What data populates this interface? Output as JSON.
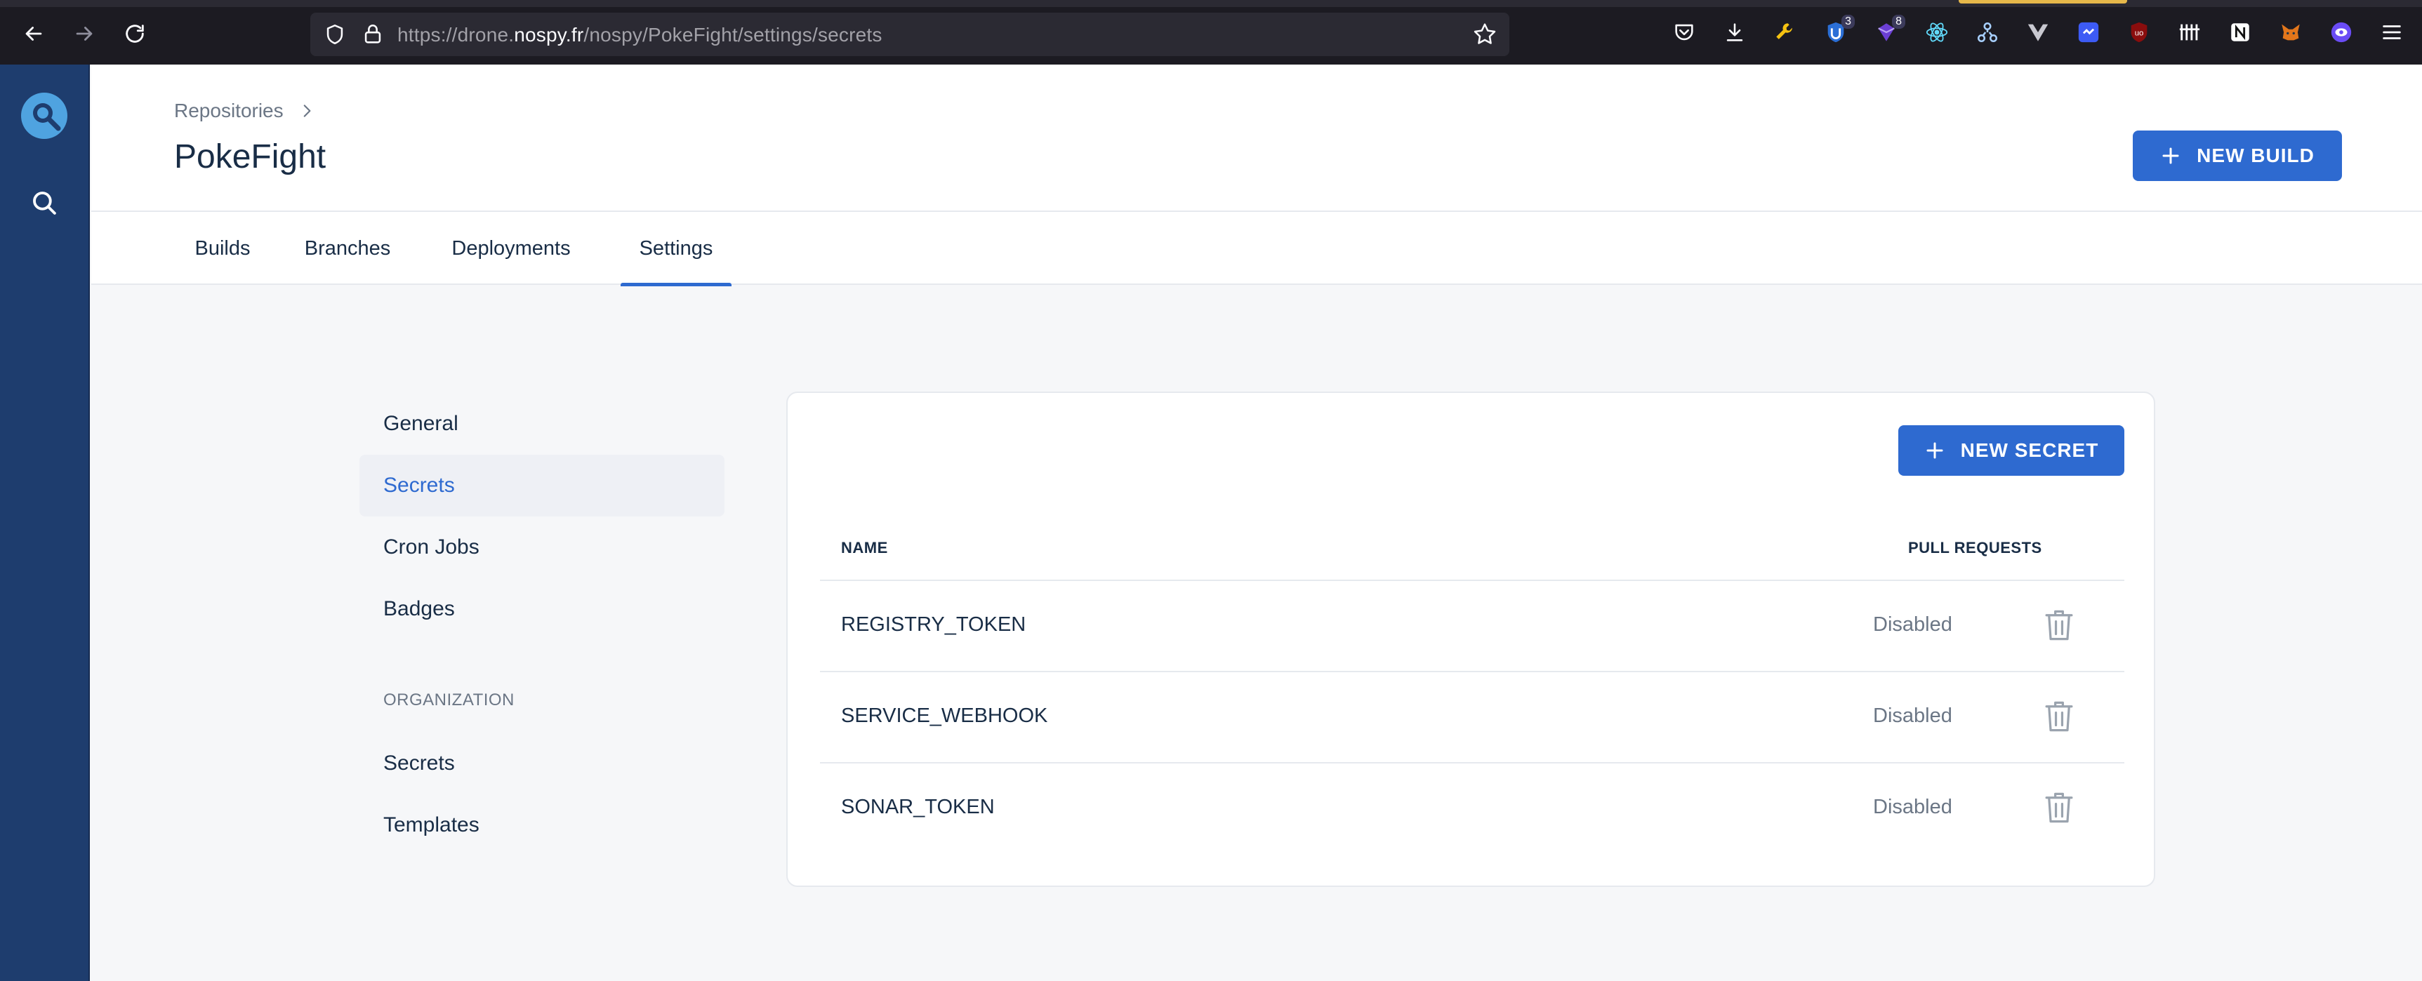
{
  "browser": {
    "url_prefix": "https://drone.",
    "url_host": "nospy.fr",
    "url_path": "/nospy/PokeFight/settings/secrets",
    "extensions": [
      {
        "icon": "pocket-icon"
      },
      {
        "icon": "download-icon"
      },
      {
        "icon": "wrench-icon"
      },
      {
        "icon": "shield-badge-icon",
        "badge": "3"
      },
      {
        "icon": "purple-extension-icon",
        "badge": "8"
      },
      {
        "icon": "react-devtools-icon"
      },
      {
        "icon": "network-icon"
      },
      {
        "icon": "vue-devtools-icon"
      },
      {
        "icon": "bitwarden-icon"
      },
      {
        "icon": "ublock-icon"
      },
      {
        "icon": "grid-icon"
      },
      {
        "icon": "notion-icon"
      },
      {
        "icon": "metamask-icon"
      },
      {
        "icon": "eye-extension-icon"
      },
      {
        "icon": "menu-icon"
      }
    ]
  },
  "header": {
    "breadcrumb": "Repositories",
    "title": "PokeFight",
    "new_build_label": "NEW BUILD"
  },
  "tabs": [
    {
      "label": "Builds",
      "active": false
    },
    {
      "label": "Branches",
      "active": false
    },
    {
      "label": "Deployments",
      "active": false
    },
    {
      "label": "Settings",
      "active": true
    }
  ],
  "settings_menu": {
    "repo_items": [
      {
        "label": "General",
        "active": false
      },
      {
        "label": "Secrets",
        "active": true
      },
      {
        "label": "Cron Jobs",
        "active": false
      },
      {
        "label": "Badges",
        "active": false
      }
    ],
    "org_heading": "ORGANIZATION",
    "org_items": [
      {
        "label": "Secrets"
      },
      {
        "label": "Templates"
      }
    ]
  },
  "secrets": {
    "new_secret_label": "NEW SECRET",
    "col_name": "NAME",
    "col_pull_requests": "PULL REQUESTS",
    "rows": [
      {
        "name": "REGISTRY_TOKEN",
        "pull_requests": "Disabled"
      },
      {
        "name": "SERVICE_WEBHOOK",
        "pull_requests": "Disabled"
      },
      {
        "name": "SONAR_TOKEN",
        "pull_requests": "Disabled"
      }
    ]
  },
  "colors": {
    "primary": "#2e6ad0",
    "rail": "#1e3d6e",
    "text": "#192d46",
    "muted": "#6b7685"
  }
}
